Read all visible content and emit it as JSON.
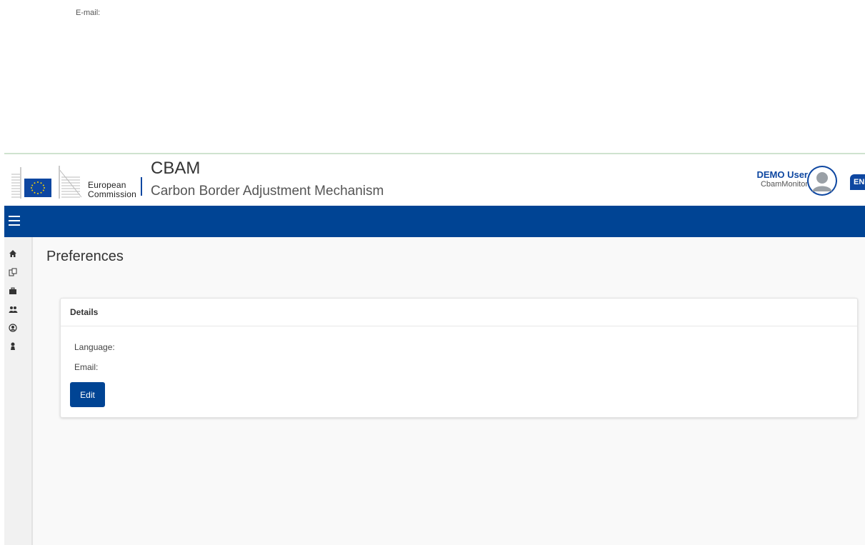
{
  "top_note": {
    "email_label": "E-mail:"
  },
  "header": {
    "org_line1": "European",
    "org_line2": "Commission",
    "title": "CBAM",
    "subtitle": "Carbon Border Adjustment Mechanism",
    "user_name": "DEMO User",
    "user_role": "CbamMonitor",
    "language_code": "EN"
  },
  "sidebar": {
    "items": [
      {
        "icon": "home-icon"
      },
      {
        "icon": "documents-icon"
      },
      {
        "icon": "briefcase-icon"
      },
      {
        "icon": "users-icon"
      },
      {
        "icon": "user-circle-icon"
      },
      {
        "icon": "person-icon"
      }
    ]
  },
  "page": {
    "title": "Preferences",
    "card": {
      "header": "Details",
      "language_label": "Language:",
      "email_label": "Email:",
      "edit_label": "Edit"
    }
  },
  "colors": {
    "primary": "#004494",
    "brand_blue": "#0e47a1"
  }
}
